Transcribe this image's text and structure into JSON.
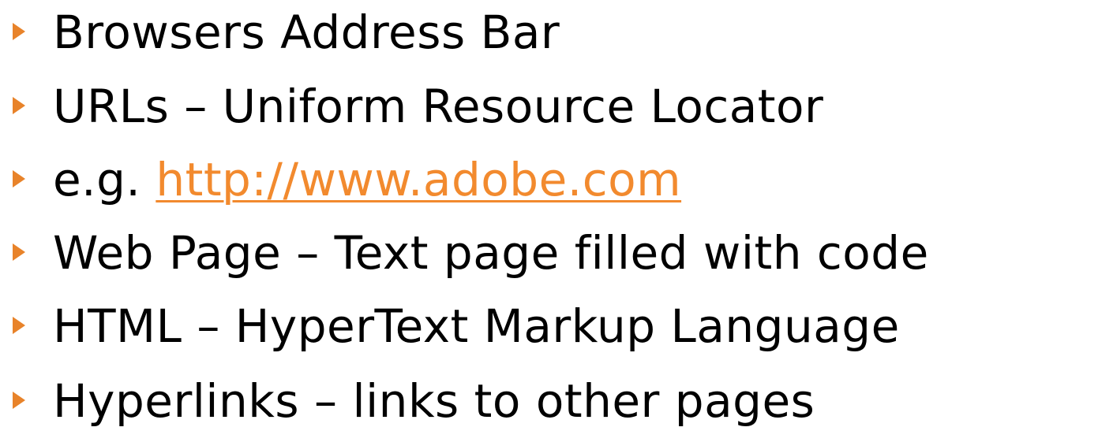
{
  "bullets": [
    {
      "text": "Browsers Address Bar"
    },
    {
      "text": "URLs – Uniform Resource Locator"
    },
    {
      "prefix": "e.g. ",
      "link": "http://www.adobe.com"
    },
    {
      "text": "Web Page – Text page filled with code"
    },
    {
      "text": "HTML – HyperText Markup Language"
    },
    {
      "text": "Hyperlinks – links to other pages"
    }
  ],
  "colors": {
    "bullet": "#e8832a",
    "link": "#f28a2e",
    "text": "#000000"
  },
  "icons": {
    "bullet_marker": "triangle-right-icon"
  }
}
